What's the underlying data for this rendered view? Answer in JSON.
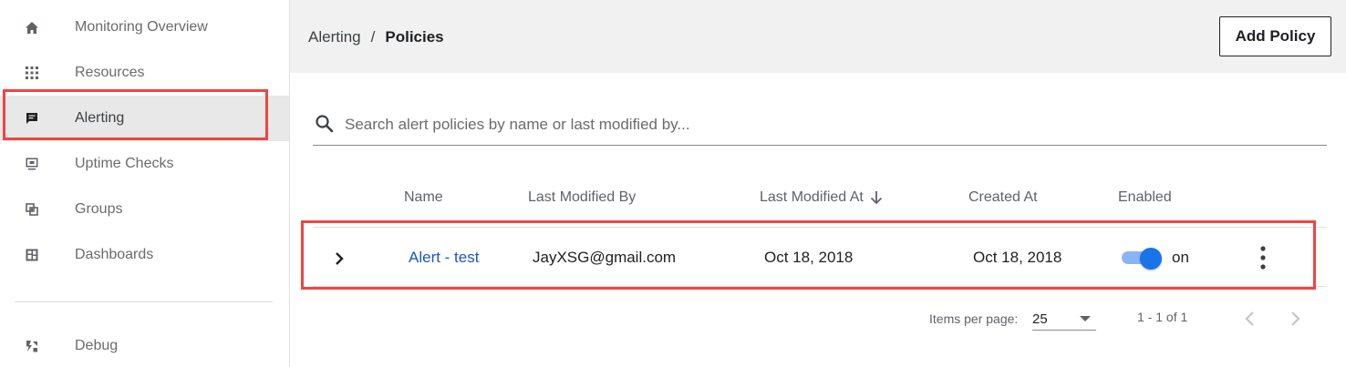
{
  "sidebar": {
    "items": [
      {
        "label": "Monitoring Overview",
        "icon": "home-icon"
      },
      {
        "label": "Resources",
        "icon": "grid-icon"
      },
      {
        "label": "Alerting",
        "icon": "chat-icon",
        "active": true
      },
      {
        "label": "Uptime Checks",
        "icon": "monitor-icon"
      },
      {
        "label": "Groups",
        "icon": "groups-icon"
      },
      {
        "label": "Dashboards",
        "icon": "dashboard-icon"
      },
      {
        "label": "Debug",
        "icon": "debug-icon"
      }
    ]
  },
  "header": {
    "breadcrumb_parent": "Alerting",
    "breadcrumb_separator": "/",
    "breadcrumb_current": "Policies",
    "add_button": "Add Policy"
  },
  "search": {
    "placeholder": "Search alert policies by name or last modified by..."
  },
  "table": {
    "columns": [
      "Name",
      "Last Modified By",
      "Last Modified At",
      "Created At",
      "Enabled"
    ],
    "sort_column": "Last Modified At",
    "sort_direction": "descending",
    "rows": [
      {
        "name": "Alert - test",
        "last_modified_by": "JayXSG@gmail.com",
        "last_modified_at": "Oct 18, 2018",
        "created_at": "Oct 18, 2018",
        "enabled": true,
        "enabled_label": "on"
      }
    ]
  },
  "pagination": {
    "items_per_page_label": "Items per page:",
    "items_per_page": "25",
    "range": "1 - 1 of 1"
  },
  "colors": {
    "accent": "#1a73e8",
    "link": "#1a56c4",
    "highlight": "#ef4444",
    "header_bg": "#f1f1f1",
    "active_nav_bg": "#e8e8e8"
  }
}
